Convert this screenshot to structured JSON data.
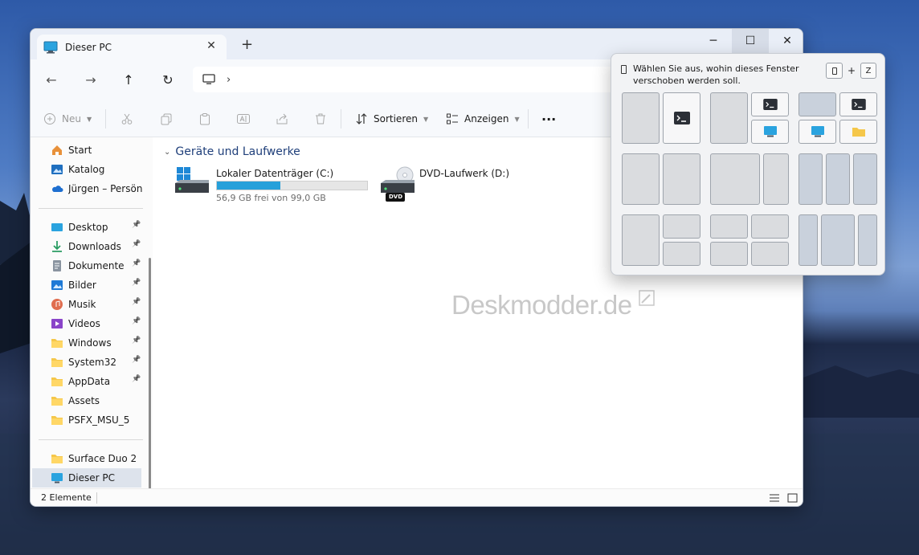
{
  "window": {
    "tab_title": "Dieser PC",
    "tab_close": "✕",
    "new_tab": "+",
    "minimize": "─",
    "maximize": "☐",
    "close": "✕"
  },
  "nav": {
    "back": "←",
    "forward": "→",
    "up": "↑",
    "refresh": "↻",
    "breadcrumb_chevron": "›"
  },
  "toolbar": {
    "new_label": "Neu",
    "sort_label": "Sortieren",
    "view_label": "Anzeigen",
    "more": "···"
  },
  "sidebar": {
    "top": [
      {
        "label": "Start",
        "icon": "home-icon"
      },
      {
        "label": "Katalog",
        "icon": "gallery-icon"
      },
      {
        "label": "Jürgen – Persönlich",
        "icon": "onedrive-icon"
      }
    ],
    "pinned": [
      {
        "label": "Desktop",
        "icon": "desktop-icon"
      },
      {
        "label": "Downloads",
        "icon": "downloads-icon"
      },
      {
        "label": "Dokumente",
        "icon": "documents-icon"
      },
      {
        "label": "Bilder",
        "icon": "pictures-icon"
      },
      {
        "label": "Musik",
        "icon": "music-icon"
      },
      {
        "label": "Videos",
        "icon": "videos-icon"
      },
      {
        "label": "Windows",
        "icon": "folder-icon"
      },
      {
        "label": "System32",
        "icon": "folder-icon"
      },
      {
        "label": "AppData",
        "icon": "folder-icon"
      }
    ],
    "unpinned": [
      {
        "label": "Assets",
        "icon": "folder-icon"
      },
      {
        "label": "PSFX_MSU_5",
        "icon": "folder-icon"
      }
    ],
    "bottom": [
      {
        "label": "Surface Duo 2",
        "icon": "folder-icon"
      },
      {
        "label": "Dieser PC",
        "icon": "pc-icon"
      }
    ]
  },
  "content": {
    "group_header": "Geräte und Laufwerke",
    "drives": [
      {
        "name": "Lokaler Datenträger (C:)",
        "subtitle": "56,9 GB frei von 99,0 GB",
        "used_fraction": 0.425
      },
      {
        "name": "DVD-Laufwerk (D:)",
        "badge": "DVD"
      }
    ],
    "watermark": "Deskmodder.de"
  },
  "status": {
    "items": "2 Elemente"
  },
  "snap": {
    "message": "Wählen Sie aus, wohin dieses Fenster verschoben werden soll.",
    "key": "Z",
    "plus": "+"
  },
  "colors": {
    "accent": "#26a0da",
    "folder": "#f5c74a",
    "selection": "#dde3ec"
  }
}
